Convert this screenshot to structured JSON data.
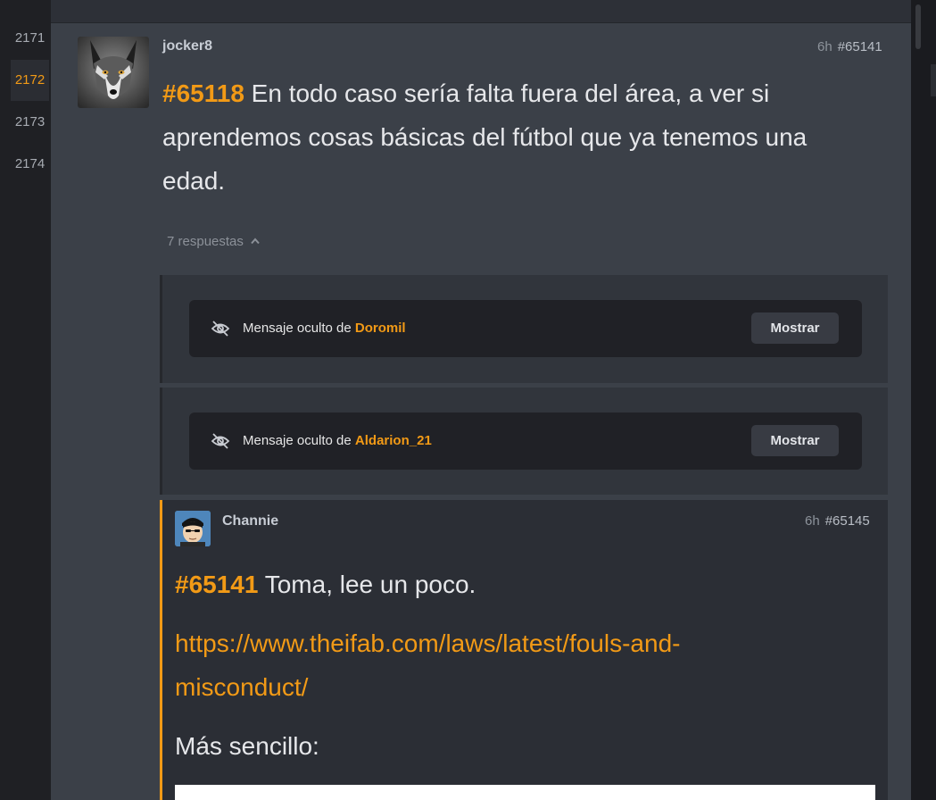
{
  "pagination": {
    "pages": [
      "2171",
      "2172",
      "2173",
      "2174"
    ],
    "active": "2172"
  },
  "post": {
    "author": "jocker8",
    "time": "6h",
    "number": "#65141",
    "quote_ref": "#65118",
    "text": "En todo caso sería falta fuera del área, a ver si aprendemos cosas básicas del fútbol que ya tenemos una edad.",
    "replies_label": "7 respuestas",
    "avatar_icon": "wolf-avatar"
  },
  "hidden_messages": [
    {
      "label": "Mensaje oculto de",
      "user": "Doromil",
      "button": "Mostrar",
      "icon": "eye-slash-icon"
    },
    {
      "label": "Mensaje oculto de",
      "user": "Aldarion_21",
      "button": "Mostrar",
      "icon": "eye-slash-icon"
    }
  ],
  "reply": {
    "author": "Channie",
    "time": "6h",
    "number": "#65145",
    "quote_ref": "#65141",
    "text": "Toma, lee un poco.",
    "link_line1": "https://www.theifab.com/laws/latest/fouls-and-",
    "link_line2": "misconduct/",
    "text2": "Más sencillo:",
    "avatar_icon": "cartoon-face-avatar"
  },
  "colors": {
    "accent": "#f29a16",
    "background": "#3b4048",
    "card": "#2b2e35"
  }
}
